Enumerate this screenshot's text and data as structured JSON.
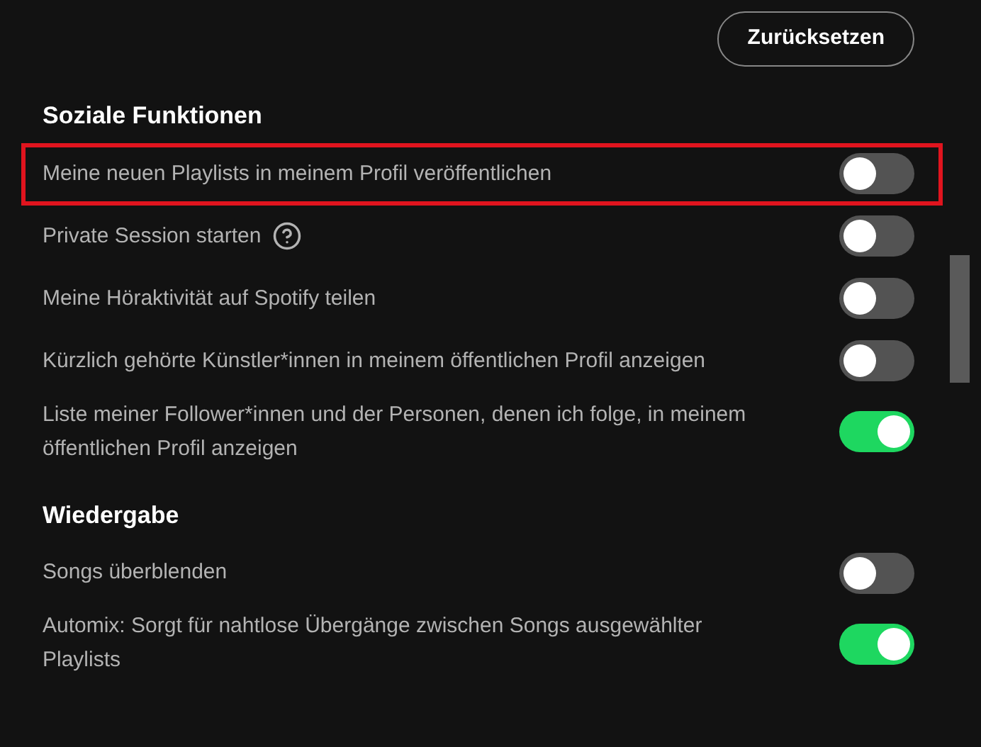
{
  "reset_button": {
    "label": "Zurücksetzen"
  },
  "sections": [
    {
      "title": "Soziale Funktionen",
      "items": [
        {
          "label": "Meine neuen Playlists in meinem Profil veröffentlichen",
          "on": false,
          "highlighted": true,
          "help": false
        },
        {
          "label": "Private Session starten",
          "on": false,
          "highlighted": false,
          "help": true
        },
        {
          "label": "Meine Höraktivität auf Spotify teilen",
          "on": false,
          "highlighted": false,
          "help": false
        },
        {
          "label": "Kürzlich gehörte Künstler*innen in meinem öffentlichen Profil anzeigen",
          "on": false,
          "highlighted": false,
          "help": false
        },
        {
          "label": "Liste meiner Follower*innen und der Personen, denen ich folge, in meinem öffentlichen Profil anzeigen",
          "on": true,
          "highlighted": false,
          "help": false
        }
      ]
    },
    {
      "title": "Wiedergabe",
      "items": [
        {
          "label": "Songs überblenden",
          "on": false,
          "highlighted": false,
          "help": false
        },
        {
          "label": "Automix: Sorgt für nahtlose Übergänge zwischen Songs ausgewählter Playlists",
          "on": true,
          "highlighted": false,
          "help": false
        }
      ]
    }
  ]
}
